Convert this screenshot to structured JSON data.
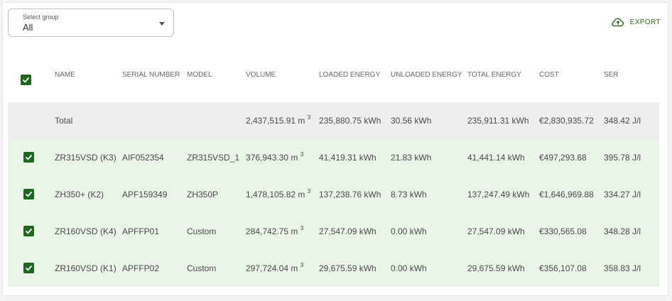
{
  "group_select": {
    "label": "Select group",
    "value": "All"
  },
  "export": {
    "label": "EXPORT",
    "icon": "cloud-upload-icon"
  },
  "colors": {
    "accent": "#1b6a1b",
    "row_bg": "#eaf4e8",
    "total_bg": "#eeeeee"
  },
  "columns": [
    "NAME",
    "SERIAL NUMBER",
    "MODEL",
    "VOLUME",
    "LOADED ENERGY",
    "UNLOADED ENERGY",
    "TOTAL ENERGY",
    "COST",
    "SER"
  ],
  "total": {
    "name": "Total",
    "serial": "",
    "model": "",
    "volume": "2,437,515.91 m",
    "loaded": "235,880.75 kWh",
    "unloaded": "30.56 kWh",
    "total_energy": "235,911.31 kWh",
    "cost": "€2,830,935.72",
    "ser": "348.42 J/l"
  },
  "rows": [
    {
      "name": "ZR315VSD (K3)",
      "serial": "AIF052354",
      "model": "ZR315VSD_1",
      "volume": "376,943.30 m",
      "loaded": "41,419.31 kWh",
      "unloaded": "21.83 kWh",
      "total_energy": "41,441.14 kWh",
      "cost": "€497,293.68",
      "ser": "395.78 J/l"
    },
    {
      "name": "ZH350+ (K2)",
      "serial": "APF159349",
      "model": "ZH350P",
      "volume": "1,478,105.82 m",
      "loaded": "137,238.76 kWh",
      "unloaded": "8.73 kWh",
      "total_energy": "137,247.49 kWh",
      "cost": "€1,646,969.88",
      "ser": "334.27 J/l"
    },
    {
      "name": "ZR160VSD (K4)",
      "serial": "APFFP01",
      "model": "Custom",
      "volume": "284,742.75 m",
      "loaded": "27,547.09 kWh",
      "unloaded": "0.00 kWh",
      "total_energy": "27,547.09 kWh",
      "cost": "€330,565.08",
      "ser": "348.28 J/l"
    },
    {
      "name": "ZR160VSD (K1)",
      "serial": "APFFP02",
      "model": "Custom",
      "volume": "297,724.04 m",
      "loaded": "29,675.59 kWh",
      "unloaded": "0.00 kWh",
      "total_energy": "29,675.59 kWh",
      "cost": "€356,107.08",
      "ser": "358.83 J/l"
    }
  ],
  "volume_unit_sup": "3"
}
